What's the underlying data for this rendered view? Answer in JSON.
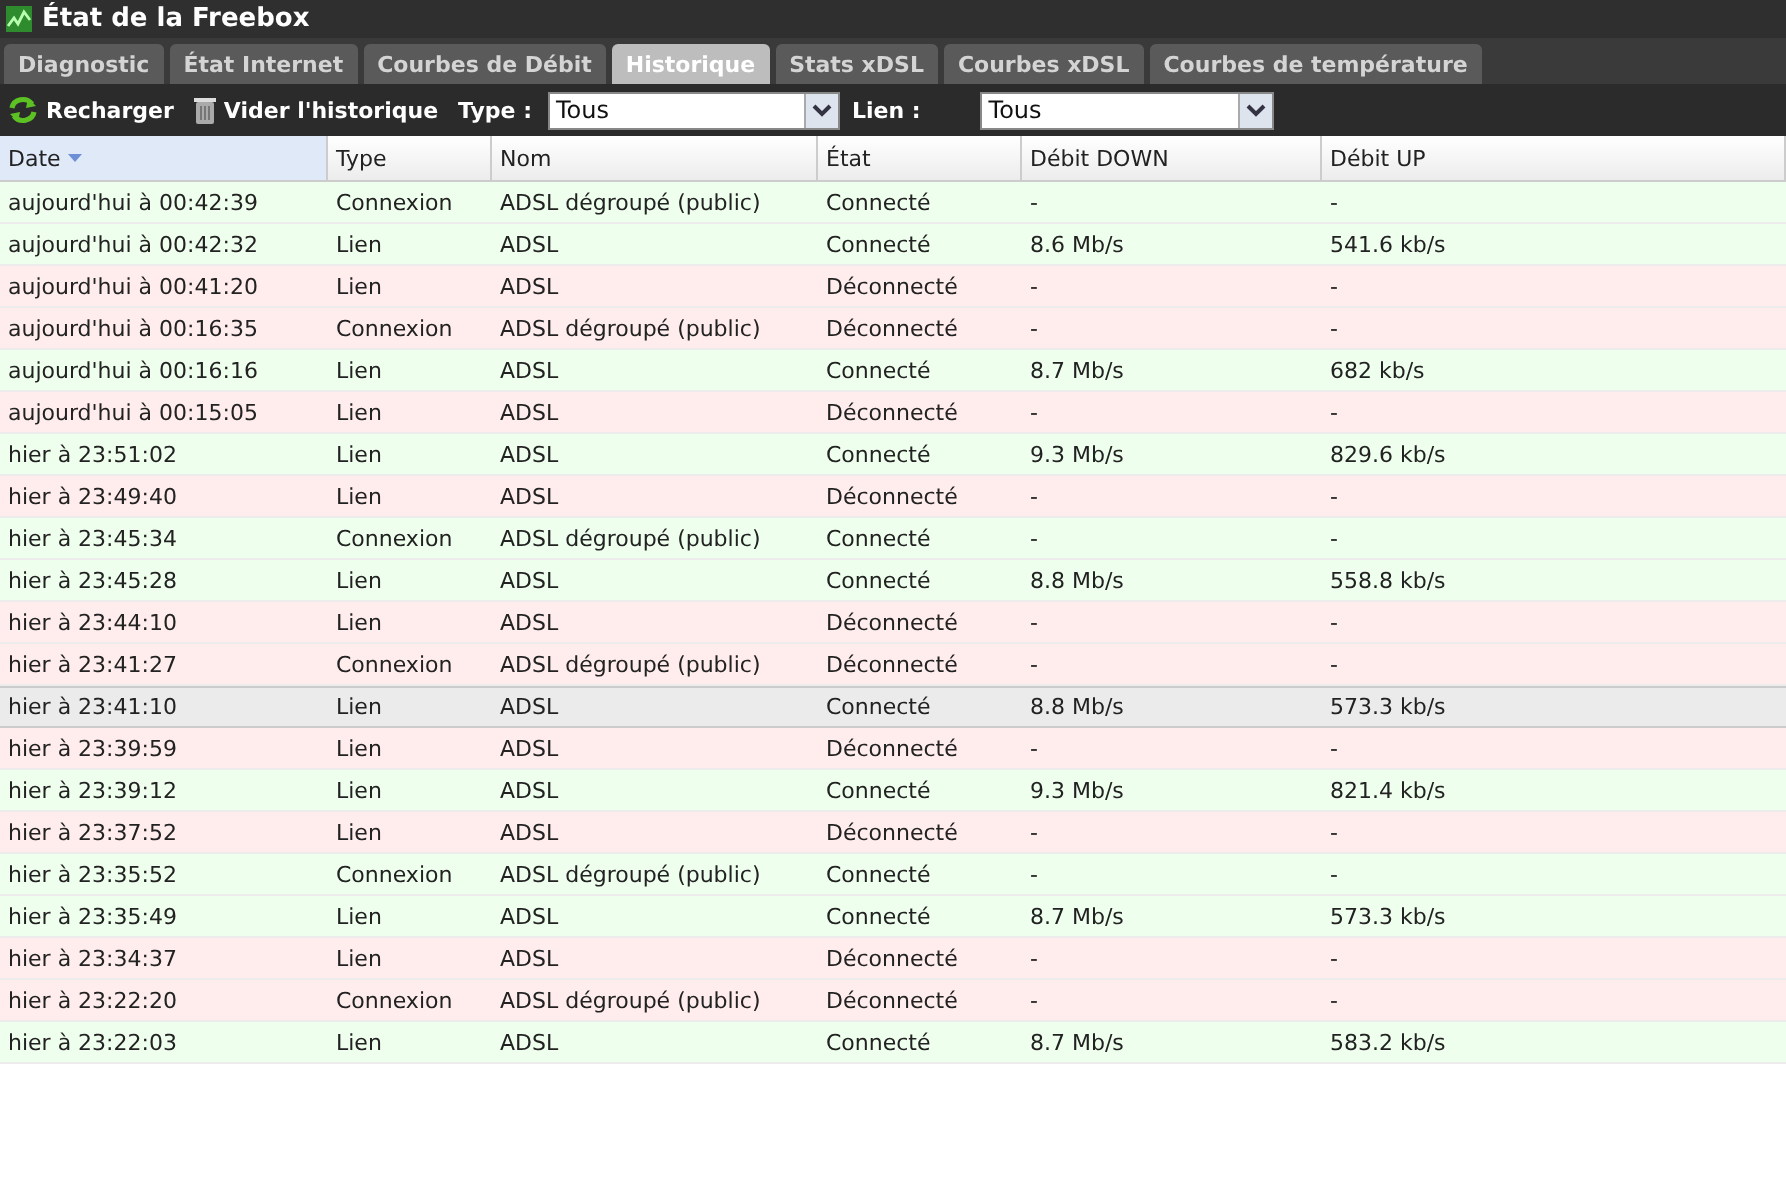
{
  "window": {
    "title": "État de la Freebox"
  },
  "tabs": [
    {
      "label": "Diagnostic",
      "selected": false
    },
    {
      "label": "État Internet",
      "selected": false
    },
    {
      "label": "Courbes de Débit",
      "selected": false
    },
    {
      "label": "Historique",
      "selected": true
    },
    {
      "label": "Stats xDSL",
      "selected": false
    },
    {
      "label": "Courbes xDSL",
      "selected": false
    },
    {
      "label": "Courbes de température",
      "selected": false
    }
  ],
  "toolbar": {
    "reload": "Recharger",
    "clear": "Vider l'historique",
    "type_label": "Type :",
    "type_value": "Tous",
    "link_label": "Lien :",
    "link_value": "Tous"
  },
  "table": {
    "columns": [
      {
        "label": "Date",
        "sorted": true
      },
      {
        "label": "Type",
        "sorted": false
      },
      {
        "label": "Nom",
        "sorted": false
      },
      {
        "label": "État",
        "sorted": false
      },
      {
        "label": "Débit DOWN",
        "sorted": false
      },
      {
        "label": "Débit UP",
        "sorted": false
      }
    ],
    "rows": [
      {
        "cells": [
          "aujourd'hui à 00:42:39",
          "Connexion",
          "ADSL dégroupé (public)",
          "Connecté",
          "-",
          "-"
        ],
        "connected": true,
        "selected": false
      },
      {
        "cells": [
          "aujourd'hui à 00:42:32",
          "Lien",
          "ADSL",
          "Connecté",
          "8.6 Mb/s",
          "541.6 kb/s"
        ],
        "connected": true,
        "selected": false
      },
      {
        "cells": [
          "aujourd'hui à 00:41:20",
          "Lien",
          "ADSL",
          "Déconnecté",
          "-",
          "-"
        ],
        "connected": false,
        "selected": false
      },
      {
        "cells": [
          "aujourd'hui à 00:16:35",
          "Connexion",
          "ADSL dégroupé (public)",
          "Déconnecté",
          "-",
          "-"
        ],
        "connected": false,
        "selected": false
      },
      {
        "cells": [
          "aujourd'hui à 00:16:16",
          "Lien",
          "ADSL",
          "Connecté",
          "8.7 Mb/s",
          "682 kb/s"
        ],
        "connected": true,
        "selected": false
      },
      {
        "cells": [
          "aujourd'hui à 00:15:05",
          "Lien",
          "ADSL",
          "Déconnecté",
          "-",
          "-"
        ],
        "connected": false,
        "selected": false
      },
      {
        "cells": [
          "hier à 23:51:02",
          "Lien",
          "ADSL",
          "Connecté",
          "9.3 Mb/s",
          "829.6 kb/s"
        ],
        "connected": true,
        "selected": false
      },
      {
        "cells": [
          "hier à 23:49:40",
          "Lien",
          "ADSL",
          "Déconnecté",
          "-",
          "-"
        ],
        "connected": false,
        "selected": false
      },
      {
        "cells": [
          "hier à 23:45:34",
          "Connexion",
          "ADSL dégroupé (public)",
          "Connecté",
          "-",
          "-"
        ],
        "connected": true,
        "selected": false
      },
      {
        "cells": [
          "hier à 23:45:28",
          "Lien",
          "ADSL",
          "Connecté",
          "8.8 Mb/s",
          "558.8 kb/s"
        ],
        "connected": true,
        "selected": false
      },
      {
        "cells": [
          "hier à 23:44:10",
          "Lien",
          "ADSL",
          "Déconnecté",
          "-",
          "-"
        ],
        "connected": false,
        "selected": false
      },
      {
        "cells": [
          "hier à 23:41:27",
          "Connexion",
          "ADSL dégroupé (public)",
          "Déconnecté",
          "-",
          "-"
        ],
        "connected": false,
        "selected": false
      },
      {
        "cells": [
          "hier à 23:41:10",
          "Lien",
          "ADSL",
          "Connecté",
          "8.8 Mb/s",
          "573.3 kb/s"
        ],
        "connected": true,
        "selected": true
      },
      {
        "cells": [
          "hier à 23:39:59",
          "Lien",
          "ADSL",
          "Déconnecté",
          "-",
          "-"
        ],
        "connected": false,
        "selected": false
      },
      {
        "cells": [
          "hier à 23:39:12",
          "Lien",
          "ADSL",
          "Connecté",
          "9.3 Mb/s",
          "821.4 kb/s"
        ],
        "connected": true,
        "selected": false
      },
      {
        "cells": [
          "hier à 23:37:52",
          "Lien",
          "ADSL",
          "Déconnecté",
          "-",
          "-"
        ],
        "connected": false,
        "selected": false
      },
      {
        "cells": [
          "hier à 23:35:52",
          "Connexion",
          "ADSL dégroupé (public)",
          "Connecté",
          "-",
          "-"
        ],
        "connected": true,
        "selected": false
      },
      {
        "cells": [
          "hier à 23:35:49",
          "Lien",
          "ADSL",
          "Connecté",
          "8.7 Mb/s",
          "573.3 kb/s"
        ],
        "connected": true,
        "selected": false
      },
      {
        "cells": [
          "hier à 23:34:37",
          "Lien",
          "ADSL",
          "Déconnecté",
          "-",
          "-"
        ],
        "connected": false,
        "selected": false
      },
      {
        "cells": [
          "hier à 23:22:20",
          "Connexion",
          "ADSL dégroupé (public)",
          "Déconnecté",
          "-",
          "-"
        ],
        "connected": false,
        "selected": false
      },
      {
        "cells": [
          "hier à 23:22:03",
          "Lien",
          "ADSL",
          "Connecté",
          "8.7 Mb/s",
          "583.2 kb/s"
        ],
        "connected": true,
        "selected": false
      }
    ]
  }
}
